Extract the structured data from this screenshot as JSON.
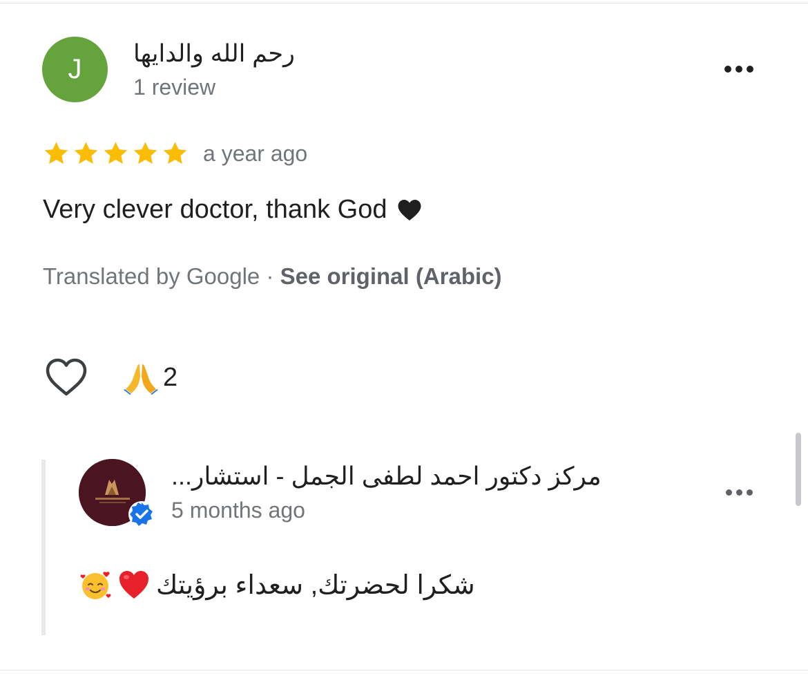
{
  "review": {
    "author_initial": "J",
    "author_name": "رحم الله والدايها",
    "author_meta": "1 review",
    "rating": 5,
    "time": "a year ago",
    "text": "Very clever doctor, thank God",
    "translated_by": "Translated by Google · ",
    "see_original": "See original (Arabic)",
    "reaction_count": "2"
  },
  "owner_reply": {
    "name": "مركز دكتور احمد لطفى الجمل - استشار...",
    "time": "5 months ago",
    "text": "شكرا لحضرتك, سعداء برؤيتك"
  },
  "icons": {
    "more": "more-horizontal-icon",
    "like": "heart-outline-icon",
    "reaction": "folded-hands-emoji",
    "verified": "verified-badge-icon"
  },
  "colors": {
    "avatar_bg": "#65a43d",
    "star": "#fbbc04",
    "secondary_text": "#70757a",
    "verified": "#1a73e8",
    "owner_avatar_bg": "#4a1520"
  }
}
